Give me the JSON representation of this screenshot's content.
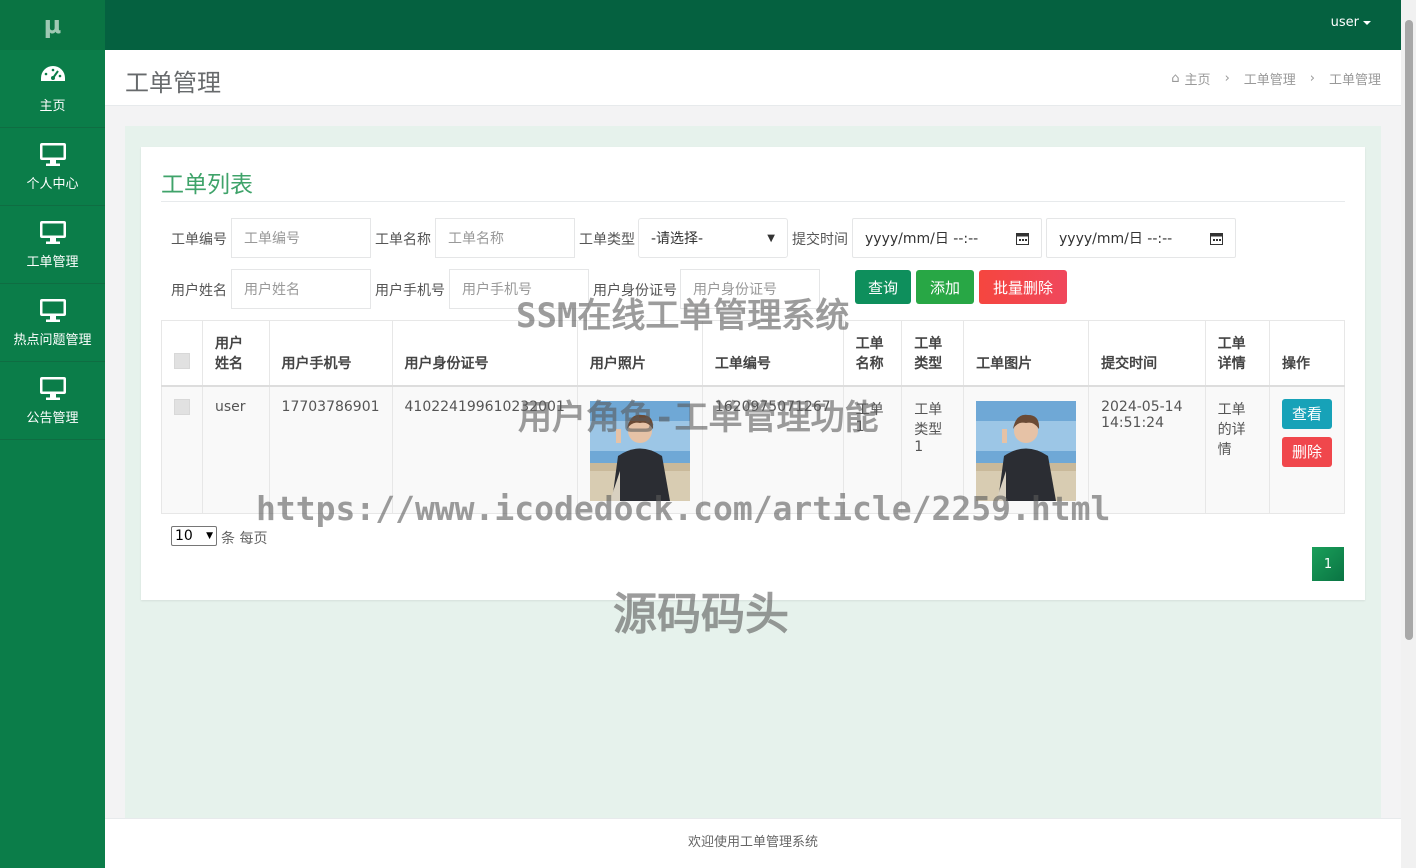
{
  "logo": "μ",
  "sidebar": {
    "items": [
      {
        "label": "主页"
      },
      {
        "label": "个人中心"
      },
      {
        "label": "工单管理"
      },
      {
        "label": "热点问题管理"
      },
      {
        "label": "公告管理"
      }
    ]
  },
  "topbar": {
    "user": "user"
  },
  "header": {
    "title": "工单管理",
    "breadcrumb": [
      "主页",
      "工单管理",
      "工单管理"
    ]
  },
  "panel": {
    "title": "工单列表"
  },
  "search": {
    "labels": {
      "gongdan_bianhao": "工单编号",
      "gongdan_mingcheng": "工单名称",
      "gongdan_leixing": "工单类型",
      "tijiao_shijian": "提交时间",
      "yonghu_xingming": "用户姓名",
      "yonghu_shoujihao": "用户手机号",
      "yonghu_shenfenzheng": "用户身份证号"
    },
    "placeholders": {
      "gongdan_bianhao": "工单编号",
      "gongdan_mingcheng": "工单名称",
      "yonghu_xingming": "用户姓名",
      "yonghu_shoujihao": "用户手机号",
      "yonghu_shenfenzheng": "用户身份证号"
    },
    "type_select": "-请选择-",
    "date_placeholder_1": "yyyy/mm/日 --:--",
    "date_placeholder_2": "yyyy/mm/日 --:--"
  },
  "buttons": {
    "query": "查询",
    "add": "添加",
    "batch_delete": "批量删除"
  },
  "colors": {
    "query": "#0e8f5c",
    "add": "#28a745",
    "batch_delete": "#f0474c",
    "view": "#17a2b8",
    "delete": "#f0474c",
    "sidebar": "#0b7d49",
    "topbar": "#056140"
  },
  "table": {
    "headers": [
      "用户姓名",
      "用户手机号",
      "用户身份证号",
      "用户照片",
      "工单编号",
      "工单名称",
      "工单类型",
      "工单图片",
      "提交时间",
      "工单详情",
      "操作"
    ],
    "rows": [
      {
        "name": "user",
        "phone": "17703786901",
        "id_card": "410224199610232001",
        "order_no": "1620975071267",
        "order_name": "工单1",
        "order_type": "工单类型1",
        "submit_time": "2024-05-14 14:51:24",
        "detail": "工单的详情",
        "view": "查看",
        "delete": "删除"
      }
    ]
  },
  "pager": {
    "page_size": "10",
    "per_page_text": "条 每页",
    "current_page": "1"
  },
  "footer": "欢迎使用工单管理系统",
  "watermarks": {
    "line1": "SSM在线工单管理系统",
    "line2": "用户角色-工单管理功能",
    "line3": "https://www.icodedock.com/article/2259.html",
    "line4": "源码码头"
  }
}
